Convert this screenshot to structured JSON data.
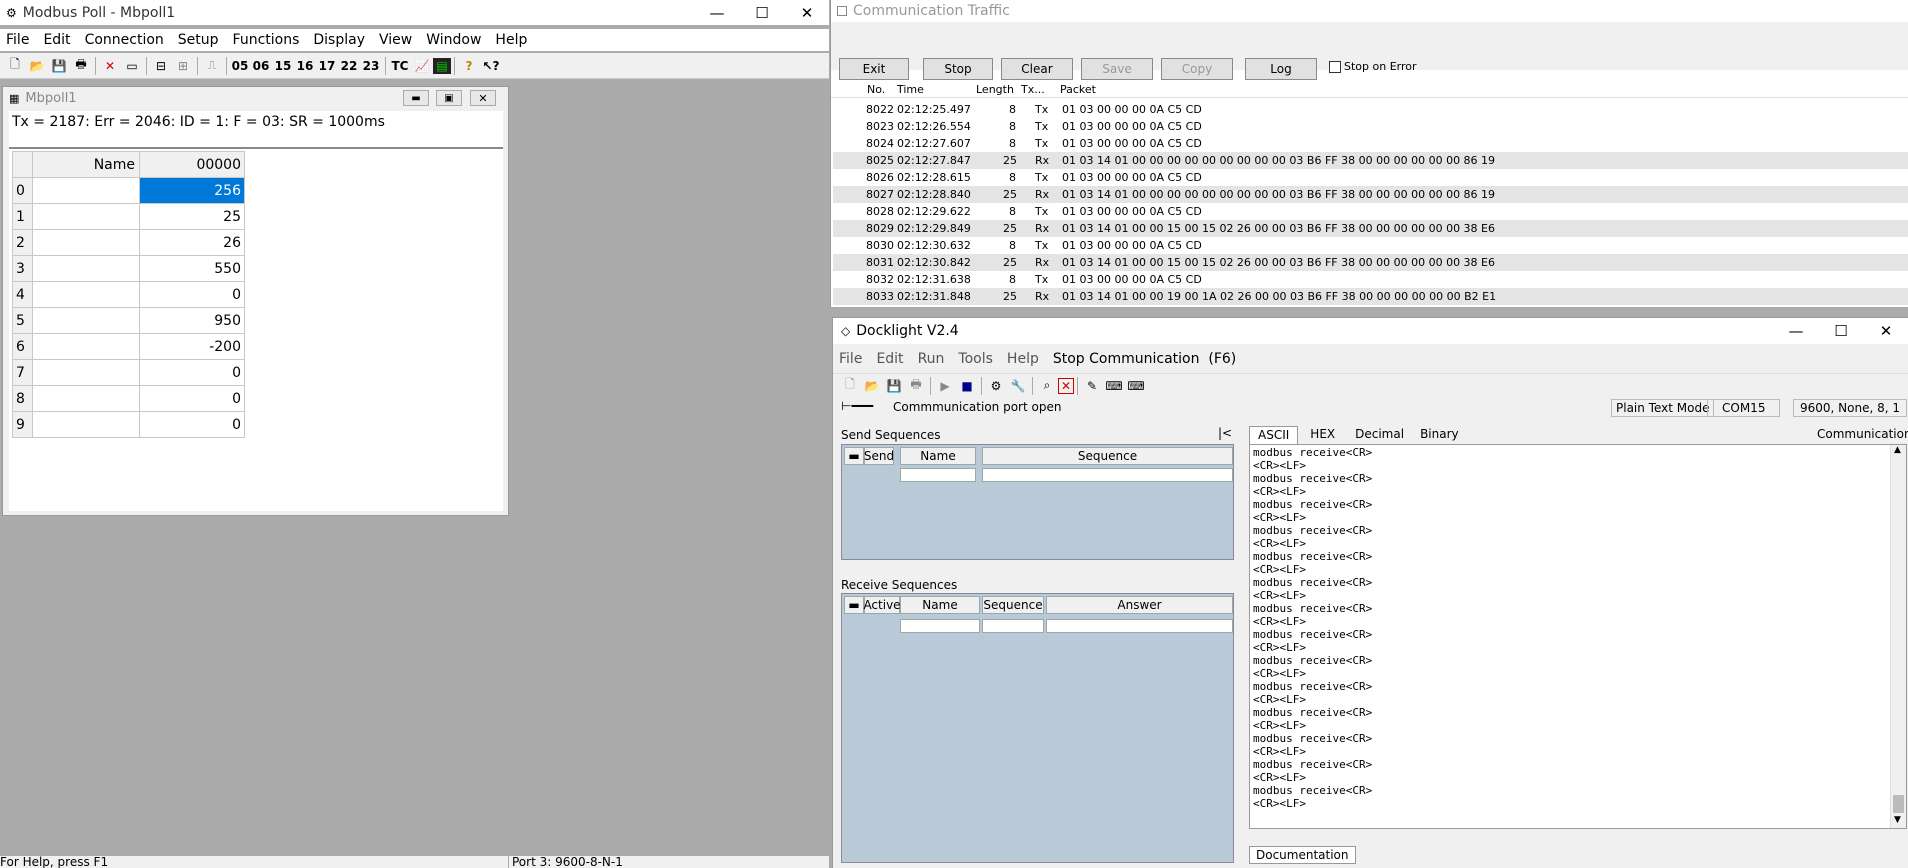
{
  "modbus_app": {
    "title": "Modbus Poll - Mbpoll1",
    "menu": [
      "File",
      "Edit",
      "Connection",
      "Setup",
      "Functions",
      "Display",
      "View",
      "Window",
      "Help"
    ],
    "toolbar_codes": [
      "05",
      "06",
      "15",
      "16",
      "17",
      "22",
      "23"
    ],
    "toolbar_tc": "TC",
    "child_title": "Mbpoll1",
    "status_line": "Tx = 2187: Err = 2046: ID = 1: F = 03: SR = 1000ms",
    "grid": {
      "col_name": "Name",
      "col_addr": "00000",
      "rows": [
        {
          "idx": "0",
          "name": "",
          "value": "256"
        },
        {
          "idx": "1",
          "name": "",
          "value": "25"
        },
        {
          "idx": "2",
          "name": "",
          "value": "26"
        },
        {
          "idx": "3",
          "name": "",
          "value": "550"
        },
        {
          "idx": "4",
          "name": "",
          "value": "0"
        },
        {
          "idx": "5",
          "name": "",
          "value": "950"
        },
        {
          "idx": "6",
          "name": "",
          "value": "-200"
        },
        {
          "idx": "7",
          "name": "",
          "value": "0"
        },
        {
          "idx": "8",
          "name": "",
          "value": "0"
        },
        {
          "idx": "9",
          "name": "",
          "value": "0"
        }
      ]
    },
    "statusbar_left": "For Help, press F1",
    "statusbar_right": "Port 3: 9600-8-N-1"
  },
  "traffic": {
    "title": "Communication Traffic",
    "buttons": {
      "exit": "Exit",
      "stop": "Stop",
      "clear": "Clear",
      "save": "Save",
      "copy": "Copy",
      "log": "Log"
    },
    "stop_on_error": "Stop on Error",
    "columns": {
      "no": "No.",
      "time": "Time",
      "length": "Length",
      "tx": "Tx...",
      "packet": "Packet"
    },
    "rows": [
      {
        "no": "8022",
        "time": "02:12:25.497",
        "length": "8",
        "dir": "Tx",
        "packet": "01 03 00 00 00 0A C5 CD"
      },
      {
        "no": "8023",
        "time": "02:12:26.554",
        "length": "8",
        "dir": "Tx",
        "packet": "01 03 00 00 00 0A C5 CD"
      },
      {
        "no": "8024",
        "time": "02:12:27.607",
        "length": "8",
        "dir": "Tx",
        "packet": "01 03 00 00 00 0A C5 CD"
      },
      {
        "no": "8025",
        "time": "02:12:27.847",
        "length": "25",
        "dir": "Rx",
        "packet": "01 03 14 01 00 00 00 00 00 00 00 00 00 03 B6 FF 38 00 00 00 00 00 00 86 19"
      },
      {
        "no": "8026",
        "time": "02:12:28.615",
        "length": "8",
        "dir": "Tx",
        "packet": "01 03 00 00 00 0A C5 CD"
      },
      {
        "no": "8027",
        "time": "02:12:28.840",
        "length": "25",
        "dir": "Rx",
        "packet": "01 03 14 01 00 00 00 00 00 00 00 00 00 03 B6 FF 38 00 00 00 00 00 00 86 19"
      },
      {
        "no": "8028",
        "time": "02:12:29.622",
        "length": "8",
        "dir": "Tx",
        "packet": "01 03 00 00 00 0A C5 CD"
      },
      {
        "no": "8029",
        "time": "02:12:29.849",
        "length": "25",
        "dir": "Rx",
        "packet": "01 03 14 01 00 00 15 00 15 02 26 00 00 03 B6 FF 38 00 00 00 00 00 00 38 E6"
      },
      {
        "no": "8030",
        "time": "02:12:30.632",
        "length": "8",
        "dir": "Tx",
        "packet": "01 03 00 00 00 0A C5 CD"
      },
      {
        "no": "8031",
        "time": "02:12:30.842",
        "length": "25",
        "dir": "Rx",
        "packet": "01 03 14 01 00 00 15 00 15 02 26 00 00 03 B6 FF 38 00 00 00 00 00 00 38 E6"
      },
      {
        "no": "8032",
        "time": "02:12:31.638",
        "length": "8",
        "dir": "Tx",
        "packet": "01 03 00 00 00 0A C5 CD"
      },
      {
        "no": "8033",
        "time": "02:12:31.848",
        "length": "25",
        "dir": "Rx",
        "packet": "01 03 14 01 00 00 19 00 1A 02 26 00 00 03 B6 FF 38 00 00 00 00 00 00 B2 E1"
      }
    ]
  },
  "docklight": {
    "title": "Docklight V2.4",
    "menu": [
      "File",
      "Edit",
      "Run",
      "Tools",
      "Help"
    ],
    "stop_comm": "Stop Communication  (F6)",
    "port_status": "Commmunication port open",
    "mode": "Plain Text Mode",
    "port": "COM15",
    "settings": "9600, None, 8, 1",
    "send_sequences": {
      "title": "Send Sequences",
      "col_send": "Send",
      "col_name": "Name",
      "col_sequence": "Sequence"
    },
    "receive_sequences": {
      "title": "Receive Sequences",
      "col_active": "Active",
      "col_name": "Name",
      "col_sequence": "Sequence",
      "col_answer": "Answer"
    },
    "tabs": [
      "ASCII",
      "HEX",
      "Decimal",
      "Binary"
    ],
    "communication_label": "Communication",
    "collapse_label": "|<",
    "terminal_lines": [
      "modbus receive<CR>",
      "<CR><LF>",
      "modbus receive<CR>",
      "<CR><LF>",
      "modbus receive<CR>",
      "<CR><LF>",
      "modbus receive<CR>",
      "<CR><LF>",
      "modbus receive<CR>",
      "<CR><LF>",
      "modbus receive<CR>",
      "<CR><LF>",
      "modbus receive<CR>",
      "<CR><LF>",
      "modbus receive<CR>",
      "<CR><LF>",
      "modbus receive<CR>",
      "<CR><LF>",
      "modbus receive<CR>",
      "<CR><LF>",
      "modbus receive<CR>",
      "<CR><LF>",
      "modbus receive<CR>",
      "<CR><LF>",
      "modbus receive<CR>",
      "<CR><LF>",
      "modbus receive<CR>",
      "<CR><LF>"
    ],
    "documentation_tab": "Documentation"
  }
}
